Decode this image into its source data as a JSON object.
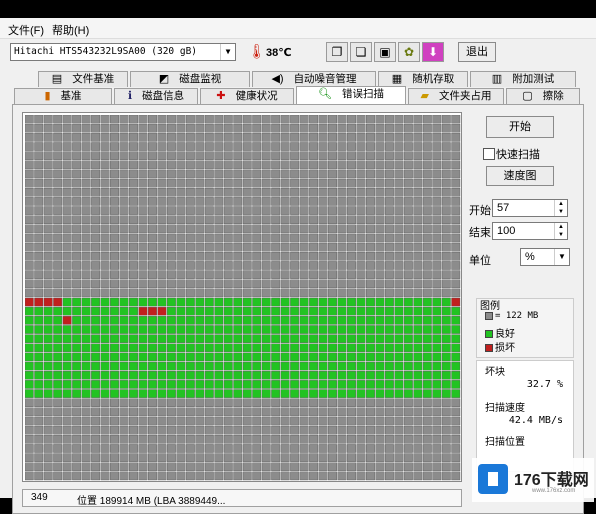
{
  "menu": {
    "file": "文件(F)",
    "help": "帮助(H)"
  },
  "toolbar": {
    "drive": "Hitachi HTS543232L9SA00 (320 gB)",
    "temperature": "38℃",
    "exit_label": "退出",
    "icons": [
      "copy-icon",
      "copy-all-icon",
      "save-icon",
      "options-icon",
      "download-icon"
    ]
  },
  "tabs_row1": [
    "文件基准",
    "磁盘监视",
    "自动噪音管理",
    "随机存取",
    "附加测试"
  ],
  "tabs_row2": [
    "基准",
    "磁盘信息",
    "健康状况",
    "错误扫描",
    "文件夹占用",
    "擦除"
  ],
  "active_tab": "错误扫描",
  "panel": {
    "start_button": "开始",
    "quick_scan_label": "快速扫描",
    "quick_scan_checked": false,
    "speed_graph_button": "速度图",
    "start_label": "开始",
    "start_value": "57",
    "end_label": "结束",
    "end_value": "100",
    "unit_label": "单位",
    "unit_value": "%"
  },
  "legend": {
    "title": "图例",
    "block_size": "= 122 MB",
    "good": "良好",
    "bad": "损坏"
  },
  "stats": {
    "damaged_label": "坏块",
    "damaged_value": "32.7 %",
    "speed_label": "扫描速度",
    "speed_value": "42.4 MB/s",
    "position_label": "扫描位置"
  },
  "status": {
    "count": "349",
    "position": "位置 189914 MB (LBA 3889449..."
  },
  "watermark": {
    "text": "176下载网",
    "sub": "www.176xz.com"
  },
  "colors": {
    "good": "#22c322",
    "bad": "#c0201e",
    "untested": "#8c8c8c",
    "grid_line": "#555555"
  },
  "scan_grid": {
    "cols": 46,
    "rows": 40,
    "good_rows": [
      20,
      21,
      22,
      23,
      24,
      25,
      26,
      27,
      28,
      29,
      30
    ],
    "good_row_start_col": [
      4,
      0,
      0,
      0,
      0,
      0,
      0,
      0,
      0,
      0,
      0
    ],
    "good_row_end_col": [
      45,
      45,
      45,
      45,
      45,
      45,
      45,
      45,
      45,
      45,
      45
    ],
    "bad_cells": [
      [
        20,
        0
      ],
      [
        20,
        1
      ],
      [
        20,
        2
      ],
      [
        20,
        3
      ],
      [
        21,
        12
      ],
      [
        21,
        13
      ],
      [
        21,
        14
      ],
      [
        22,
        4
      ],
      [
        20,
        45
      ]
    ]
  }
}
